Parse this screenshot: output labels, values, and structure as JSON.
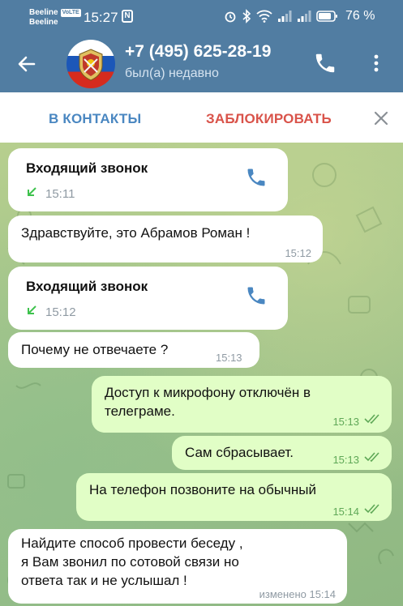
{
  "status_bar": {
    "carrier1": "Beeline",
    "volte": "VoLTE",
    "carrier2": "Beeline",
    "time": "15:27",
    "notification": "N",
    "battery": "76 %"
  },
  "header": {
    "title": "+7 (495) 625-28-19",
    "subtitle": "был(а) недавно"
  },
  "actions": {
    "add_contact": "В КОНТАКТЫ",
    "block": "ЗАБЛОКИРОВАТЬ"
  },
  "messages": [
    {
      "type": "call",
      "direction": "in",
      "title": "Входящий звонок",
      "time": "15:11"
    },
    {
      "type": "text",
      "direction": "in",
      "text": "Здравствуйте, это Абрамов Роман !",
      "time": "15:12"
    },
    {
      "type": "call",
      "direction": "in",
      "title": "Входящий звонок",
      "time": "15:12"
    },
    {
      "type": "text",
      "direction": "in",
      "text": "Почему не отвечаете ?",
      "time": "15:13"
    },
    {
      "type": "text",
      "direction": "out",
      "text": "Доступ к микрофону отключён в\nтелеграме.",
      "time": "15:13",
      "read": true
    },
    {
      "type": "text",
      "direction": "out",
      "text": "Сам сбрасывает.",
      "time": "15:13",
      "read": true
    },
    {
      "type": "text",
      "direction": "out",
      "text": "На телефон позвоните на обычный",
      "time": "15:14",
      "read": true
    },
    {
      "type": "text",
      "direction": "in",
      "text": "Найдите способ провести беседу ,\nя Вам звонил по сотовой связи но\nответа так и не услышал !",
      "time": "изменено 15:14"
    }
  ],
  "colors": {
    "header": "#517da2",
    "accent_blue": "#4a87c1",
    "block_red": "#d9534a",
    "incoming_bubble": "#ffffff",
    "outgoing_bubble": "#e1fec6",
    "call_arrow_green": "#3ec24d"
  },
  "icons": {
    "back": "arrow-left-icon",
    "call": "phone-icon",
    "menu": "more-vertical-icon",
    "close": "close-icon",
    "incoming_call": "arrow-down-left-icon",
    "read": "double-check-icon"
  }
}
